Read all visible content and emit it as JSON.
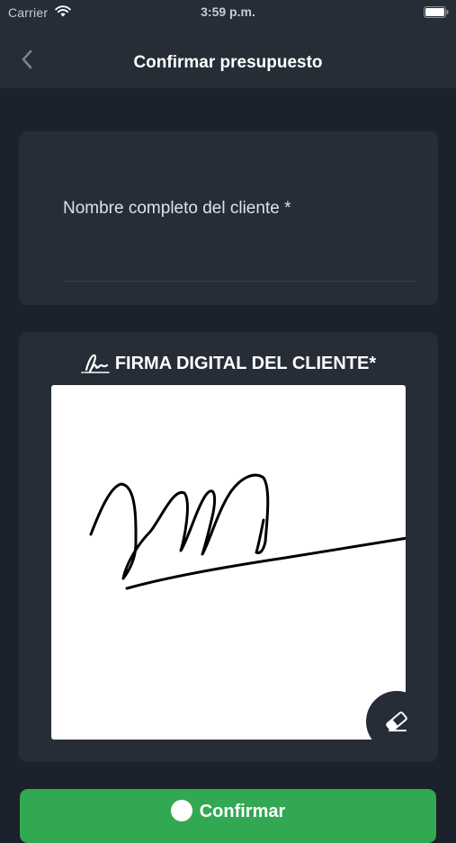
{
  "status_bar": {
    "carrier": "Carrier",
    "time": "3:59 p.m.",
    "icons": [
      "wifi-icon",
      "battery-icon"
    ]
  },
  "nav": {
    "back_icon": "chevron-left-icon",
    "title": "Confirmar presupuesto"
  },
  "client_form": {
    "name_label": "Nombre completo del cliente *",
    "name_value": ""
  },
  "signature": {
    "icon": "signature-icon",
    "title": "FIRMA DIGITAL DEL CLIENTE*",
    "erase_icon": "eraser-icon"
  },
  "confirm": {
    "icon": "check-circle-icon",
    "label": "Confirmar"
  },
  "colors": {
    "background": "#1c222b",
    "surface": "#262d37",
    "accent_green": "#32a852",
    "text": "#ffffff"
  }
}
